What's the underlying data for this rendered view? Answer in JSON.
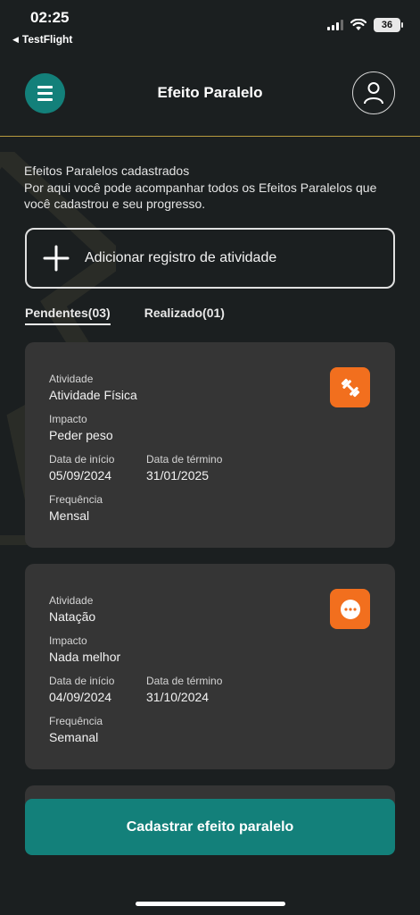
{
  "status_bar": {
    "time": "02:25",
    "back_app": "TestFlight",
    "battery": "36"
  },
  "header": {
    "title": "Efeito Paralelo"
  },
  "intro": {
    "title": "Efeitos Paralelos cadastrados",
    "description": "Por aqui você pode acompanhar todos os Efeitos Paralelos que você cadastrou e seu progresso."
  },
  "add_button": {
    "label": "Adicionar registro de atividade"
  },
  "tabs": [
    {
      "label": "Pendentes(03)",
      "active": true
    },
    {
      "label": "Realizado(01)",
      "active": false
    }
  ],
  "cards": [
    {
      "activity_label": "Atividade",
      "activity": "Atividade Física",
      "impact_label": "Impacto",
      "impact": "Peder peso",
      "start_label": "Data de início",
      "start": "05/09/2024",
      "end_label": "Data de término",
      "end": "31/01/2025",
      "frequency_label": "Frequência",
      "frequency": "Mensal",
      "icon": "dumbbell-icon"
    },
    {
      "activity_label": "Atividade",
      "activity": "Natação",
      "impact_label": "Impacto",
      "impact": "Nada melhor",
      "start_label": "Data de início",
      "start": "04/09/2024",
      "end_label": "Data de término",
      "end": "31/10/2024",
      "frequency_label": "Frequência",
      "frequency": "Semanal",
      "icon": "more-dots-icon"
    }
  ],
  "cta": {
    "label": "Cadastrar efeito paralelo"
  },
  "colors": {
    "background": "#1b1f20",
    "card": "#353535",
    "teal": "#13807a",
    "orange": "#f26f1e",
    "divider": "#b79a3e"
  }
}
